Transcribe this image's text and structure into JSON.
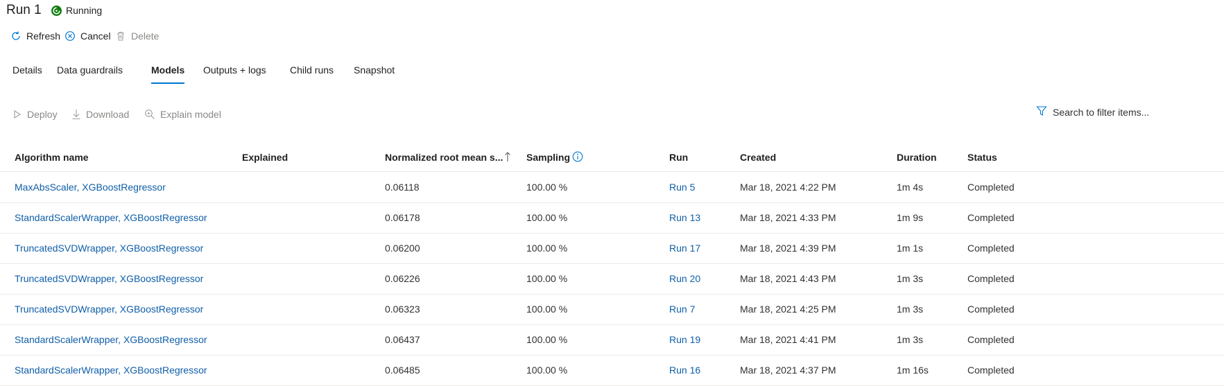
{
  "header": {
    "title": "Run 1",
    "status": "Running"
  },
  "commands": {
    "refresh": "Refresh",
    "cancel": "Cancel",
    "delete": "Delete"
  },
  "tabs": [
    {
      "label": "Details"
    },
    {
      "label": "Data guardrails"
    },
    {
      "label": "Models",
      "active": true
    },
    {
      "label": "Outputs + logs"
    },
    {
      "label": "Child runs"
    },
    {
      "label": "Snapshot"
    }
  ],
  "toolbar": {
    "deploy": "Deploy",
    "download": "Download",
    "explain": "Explain model"
  },
  "search": {
    "placeholder": "Search to filter items..."
  },
  "columns": {
    "algorithm": "Algorithm name",
    "explained": "Explained",
    "nrmse": "Normalized root mean s...",
    "sampling": "Sampling",
    "run": "Run",
    "created": "Created",
    "duration": "Duration",
    "status": "Status"
  },
  "rows": [
    {
      "algorithm": "MaxAbsScaler, XGBoostRegressor",
      "explained": "",
      "nrmse": "0.06118",
      "sampling": "100.00 %",
      "run": "Run 5",
      "created": "Mar 18, 2021 4:22 PM",
      "duration": "1m 4s",
      "status": "Completed"
    },
    {
      "algorithm": "StandardScalerWrapper, XGBoostRegressor",
      "explained": "",
      "nrmse": "0.06178",
      "sampling": "100.00 %",
      "run": "Run 13",
      "created": "Mar 18, 2021 4:33 PM",
      "duration": "1m 9s",
      "status": "Completed"
    },
    {
      "algorithm": "TruncatedSVDWrapper, XGBoostRegressor",
      "explained": "",
      "nrmse": "0.06200",
      "sampling": "100.00 %",
      "run": "Run 17",
      "created": "Mar 18, 2021 4:39 PM",
      "duration": "1m 1s",
      "status": "Completed"
    },
    {
      "algorithm": "TruncatedSVDWrapper, XGBoostRegressor",
      "explained": "",
      "nrmse": "0.06226",
      "sampling": "100.00 %",
      "run": "Run 20",
      "created": "Mar 18, 2021 4:43 PM",
      "duration": "1m 3s",
      "status": "Completed"
    },
    {
      "algorithm": "TruncatedSVDWrapper, XGBoostRegressor",
      "explained": "",
      "nrmse": "0.06323",
      "sampling": "100.00 %",
      "run": "Run 7",
      "created": "Mar 18, 2021 4:25 PM",
      "duration": "1m 3s",
      "status": "Completed"
    },
    {
      "algorithm": "StandardScalerWrapper, XGBoostRegressor",
      "explained": "",
      "nrmse": "0.06437",
      "sampling": "100.00 %",
      "run": "Run 19",
      "created": "Mar 18, 2021 4:41 PM",
      "duration": "1m 3s",
      "status": "Completed"
    },
    {
      "algorithm": "StandardScalerWrapper, XGBoostRegressor",
      "explained": "",
      "nrmse": "0.06485",
      "sampling": "100.00 %",
      "run": "Run 16",
      "created": "Mar 18, 2021 4:37 PM",
      "duration": "1m 16s",
      "status": "Completed"
    }
  ],
  "colors": {
    "accent": "#0078d4",
    "link": "#0f5ea8",
    "running": "#107c10",
    "disabled": "#8a8886"
  },
  "icons": {
    "status": "running-icon",
    "refresh": "refresh-icon",
    "cancel": "cancel-icon",
    "delete": "trash-icon",
    "deploy": "play-icon",
    "download": "download-icon",
    "explain": "search-icon",
    "filter": "filter-icon",
    "sort": "arrow-up-icon",
    "info": "info-icon"
  }
}
